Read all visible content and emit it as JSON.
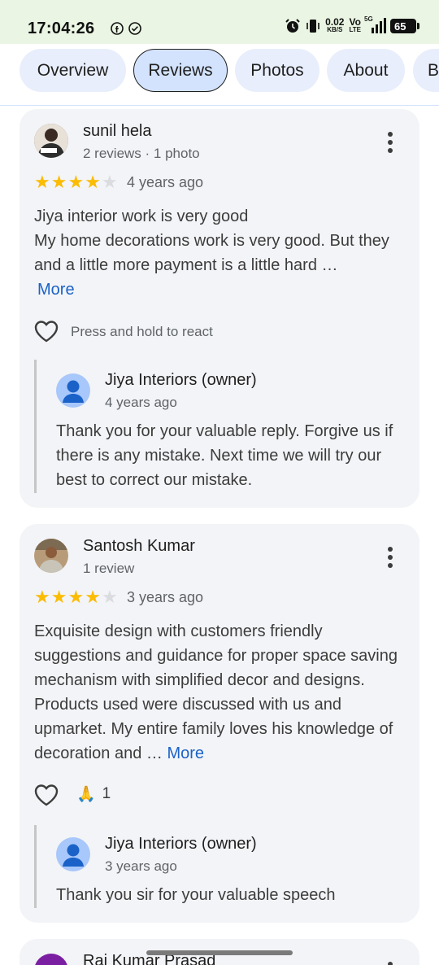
{
  "status_bar": {
    "time": "17:04:26",
    "left_icons": [
      "facebook-icon",
      "check-circle-icon"
    ],
    "network_speed": "0.02",
    "network_unit": "KB/S",
    "volte": "Vo",
    "lte": "LTE",
    "signal_tag": "5G",
    "battery": "65"
  },
  "tabs": [
    {
      "label": "Overview",
      "active": false
    },
    {
      "label": "Reviews",
      "active": true
    },
    {
      "label": "Photos",
      "active": false
    },
    {
      "label": "About",
      "active": false
    },
    {
      "label": "B",
      "active": false
    }
  ],
  "reviews": [
    {
      "name": "sunil hela",
      "meta": "2 reviews · 1 photo",
      "rating": 4,
      "time": "4 years ago",
      "text": "Jiya interior work is very good\nMy home decorations work is very good. But they and a little more payment is a little hard …",
      "more_label": "More",
      "react_label": "Press and hold to react",
      "owner_name": "Jiya Interiors (owner)",
      "owner_time": "4 years ago",
      "owner_reply": "Thank you for your valuable reply. Forgive us if there is any mistake. Next time we will try our best to correct our mistake."
    },
    {
      "name": "Santosh Kumar",
      "meta": "1 review",
      "rating": 4,
      "time": "3 years ago",
      "text": "Exquisite design with customers friendly suggestions and guidance for proper space saving mechanism with simplified decor and designs. Products used were discussed with us and upmarket. My entire family loves his knowledge of decoration and …",
      "more_label": "More",
      "reaction_emoji": "🙏",
      "reaction_count": "1",
      "owner_name": "Jiya Interiors (owner)",
      "owner_time": "3 years ago",
      "owner_reply": "Thank you sir for your valuable speech"
    },
    {
      "name": "Raj Kumar Prasad"
    }
  ],
  "colors": {
    "star": "#fbbc04",
    "link": "#1a62c8",
    "tab_active": "#d3e3fd",
    "card_bg": "#f3f4f7"
  }
}
